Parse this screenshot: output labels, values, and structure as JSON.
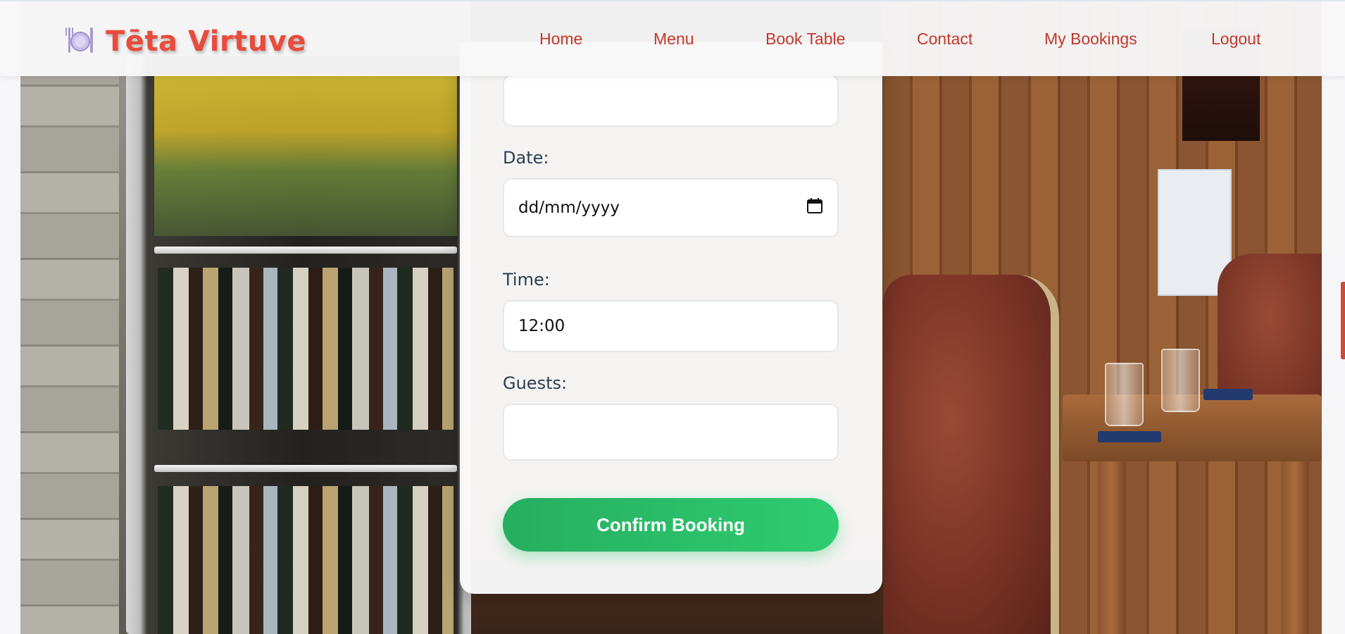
{
  "brand": {
    "name": "Tēta Virtuve",
    "icon": "plate-cutlery-icon"
  },
  "nav": {
    "items": [
      {
        "label": "Home"
      },
      {
        "label": "Menu"
      },
      {
        "label": "Book Table"
      },
      {
        "label": "Contact"
      },
      {
        "label": "My Bookings"
      },
      {
        "label": "Logout"
      }
    ]
  },
  "form": {
    "top_field": {
      "value": ""
    },
    "date": {
      "label": "Date:",
      "value": "dd/mm/yyyy",
      "icon": "calendar-icon"
    },
    "time": {
      "label": "Time:",
      "value": "12:00"
    },
    "guests": {
      "label": "Guests:",
      "value": ""
    },
    "confirm_label": "Confirm Booking"
  },
  "colors": {
    "brand": "#e74c3c",
    "nav_link": "#c0392b",
    "button_start": "#27ae60",
    "button_end": "#2ecc71",
    "label": "#2c3e50"
  }
}
